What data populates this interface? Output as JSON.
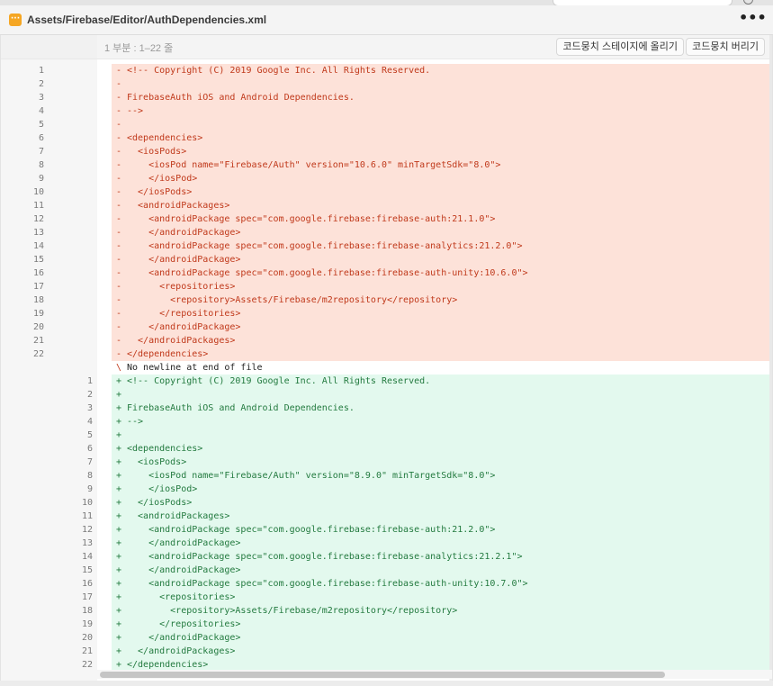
{
  "header": {
    "file_path": "Assets/Firebase/Editor/AuthDependencies.xml",
    "file_icon_glyph": "···",
    "more_glyph": "•••"
  },
  "hunk": {
    "range_label": "1 부분 : 1–22 줄",
    "stage_label": "코드뭉치 스테이지에 올리기",
    "discard_label": "코드뭉치 버리기"
  },
  "colors": {
    "deleted_bg": "#fde2d9",
    "deleted_text": "#c0391b",
    "added_bg": "#e3f9ee",
    "added_text": "#237a3f",
    "file_icon": "#f5a623"
  },
  "diff_lines": [
    {
      "type": "del",
      "old": "1",
      "new": "",
      "sign": "-",
      "text": "<!-- Copyright (C) 2019 Google Inc. All Rights Reserved."
    },
    {
      "type": "del",
      "old": "2",
      "new": "",
      "sign": "-",
      "text": ""
    },
    {
      "type": "del",
      "old": "3",
      "new": "",
      "sign": "-",
      "text": "FirebaseAuth iOS and Android Dependencies."
    },
    {
      "type": "del",
      "old": "4",
      "new": "",
      "sign": "-",
      "text": "-->"
    },
    {
      "type": "del",
      "old": "5",
      "new": "",
      "sign": "-",
      "text": ""
    },
    {
      "type": "del",
      "old": "6",
      "new": "",
      "sign": "-",
      "text": "<dependencies>"
    },
    {
      "type": "del",
      "old": "7",
      "new": "",
      "sign": "-",
      "text": "  <iosPods>"
    },
    {
      "type": "del",
      "old": "8",
      "new": "",
      "sign": "-",
      "text": "    <iosPod name=\"Firebase/Auth\" version=\"10.6.0\" minTargetSdk=\"8.0\">"
    },
    {
      "type": "del",
      "old": "9",
      "new": "",
      "sign": "-",
      "text": "    </iosPod>"
    },
    {
      "type": "del",
      "old": "10",
      "new": "",
      "sign": "-",
      "text": "  </iosPods>"
    },
    {
      "type": "del",
      "old": "11",
      "new": "",
      "sign": "-",
      "text": "  <androidPackages>"
    },
    {
      "type": "del",
      "old": "12",
      "new": "",
      "sign": "-",
      "text": "    <androidPackage spec=\"com.google.firebase:firebase-auth:21.1.0\">"
    },
    {
      "type": "del",
      "old": "13",
      "new": "",
      "sign": "-",
      "text": "    </androidPackage>"
    },
    {
      "type": "del",
      "old": "14",
      "new": "",
      "sign": "-",
      "text": "    <androidPackage spec=\"com.google.firebase:firebase-analytics:21.2.0\">"
    },
    {
      "type": "del",
      "old": "15",
      "new": "",
      "sign": "-",
      "text": "    </androidPackage>"
    },
    {
      "type": "del",
      "old": "16",
      "new": "",
      "sign": "-",
      "text": "    <androidPackage spec=\"com.google.firebase:firebase-auth-unity:10.6.0\">"
    },
    {
      "type": "del",
      "old": "17",
      "new": "",
      "sign": "-",
      "text": "      <repositories>"
    },
    {
      "type": "del",
      "old": "18",
      "new": "",
      "sign": "-",
      "text": "        <repository>Assets/Firebase/m2repository</repository>"
    },
    {
      "type": "del",
      "old": "19",
      "new": "",
      "sign": "-",
      "text": "      </repositories>"
    },
    {
      "type": "del",
      "old": "20",
      "new": "",
      "sign": "-",
      "text": "    </androidPackage>"
    },
    {
      "type": "del",
      "old": "21",
      "new": "",
      "sign": "-",
      "text": "  </androidPackages>"
    },
    {
      "type": "del",
      "old": "22",
      "new": "",
      "sign": "-",
      "text": "</dependencies>"
    },
    {
      "type": "noeol",
      "old": "",
      "new": "",
      "sign": "\\",
      "text": "No newline at end of file"
    },
    {
      "type": "add",
      "old": "",
      "new": "1",
      "sign": "+",
      "text": "<!-- Copyright (C) 2019 Google Inc. All Rights Reserved."
    },
    {
      "type": "add",
      "old": "",
      "new": "2",
      "sign": "+",
      "text": ""
    },
    {
      "type": "add",
      "old": "",
      "new": "3",
      "sign": "+",
      "text": "FirebaseAuth iOS and Android Dependencies."
    },
    {
      "type": "add",
      "old": "",
      "new": "4",
      "sign": "+",
      "text": "-->"
    },
    {
      "type": "add",
      "old": "",
      "new": "5",
      "sign": "+",
      "text": ""
    },
    {
      "type": "add",
      "old": "",
      "new": "6",
      "sign": "+",
      "text": "<dependencies>"
    },
    {
      "type": "add",
      "old": "",
      "new": "7",
      "sign": "+",
      "text": "  <iosPods>"
    },
    {
      "type": "add",
      "old": "",
      "new": "8",
      "sign": "+",
      "text": "    <iosPod name=\"Firebase/Auth\" version=\"8.9.0\" minTargetSdk=\"8.0\">"
    },
    {
      "type": "add",
      "old": "",
      "new": "9",
      "sign": "+",
      "text": "    </iosPod>"
    },
    {
      "type": "add",
      "old": "",
      "new": "10",
      "sign": "+",
      "text": "  </iosPods>"
    },
    {
      "type": "add",
      "old": "",
      "new": "11",
      "sign": "+",
      "text": "  <androidPackages>"
    },
    {
      "type": "add",
      "old": "",
      "new": "12",
      "sign": "+",
      "text": "    <androidPackage spec=\"com.google.firebase:firebase-auth:21.2.0\">"
    },
    {
      "type": "add",
      "old": "",
      "new": "13",
      "sign": "+",
      "text": "    </androidPackage>"
    },
    {
      "type": "add",
      "old": "",
      "new": "14",
      "sign": "+",
      "text": "    <androidPackage spec=\"com.google.firebase:firebase-analytics:21.2.1\">"
    },
    {
      "type": "add",
      "old": "",
      "new": "15",
      "sign": "+",
      "text": "    </androidPackage>"
    },
    {
      "type": "add",
      "old": "",
      "new": "16",
      "sign": "+",
      "text": "    <androidPackage spec=\"com.google.firebase:firebase-auth-unity:10.7.0\">"
    },
    {
      "type": "add",
      "old": "",
      "new": "17",
      "sign": "+",
      "text": "      <repositories>"
    },
    {
      "type": "add",
      "old": "",
      "new": "18",
      "sign": "+",
      "text": "        <repository>Assets/Firebase/m2repository</repository>"
    },
    {
      "type": "add",
      "old": "",
      "new": "19",
      "sign": "+",
      "text": "      </repositories>"
    },
    {
      "type": "add",
      "old": "",
      "new": "20",
      "sign": "+",
      "text": "    </androidPackage>"
    },
    {
      "type": "add",
      "old": "",
      "new": "21",
      "sign": "+",
      "text": "  </androidPackages>"
    },
    {
      "type": "add",
      "old": "",
      "new": "22",
      "sign": "+",
      "text": "</dependencies>"
    }
  ]
}
